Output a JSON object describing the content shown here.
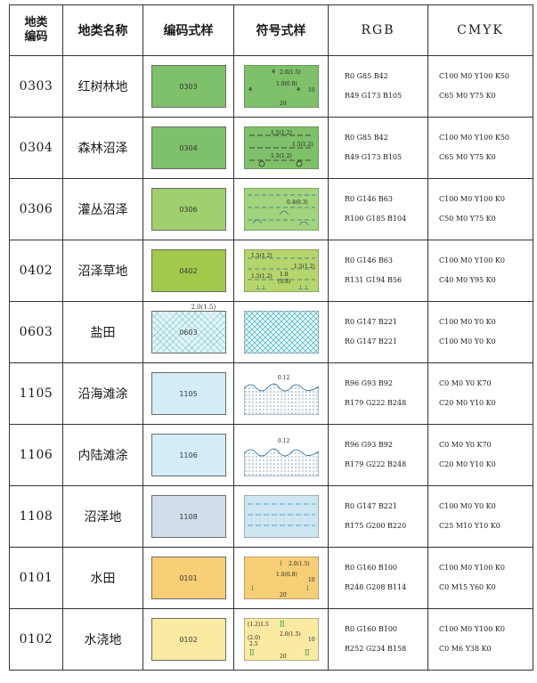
{
  "headers": {
    "code": "地类\n编码",
    "name": "地类名称",
    "swatch": "编码式样",
    "symbol": "符号式样",
    "rgb": "RGB",
    "cmyk": "CMYK"
  },
  "rows": [
    {
      "code": "0303",
      "name": "红树林地",
      "swatch_label": "0303",
      "swatch_color": "#7fc06a",
      "symbol_labels": [
        "2.0(1.5)",
        "1.0(0.8)",
        "10",
        "20"
      ],
      "rgb": [
        "R0  G85  B42",
        "R49  G173  B105"
      ],
      "cmyk": [
        "C100  M0  Y100  K50",
        "C65  M0  Y75  K0"
      ]
    },
    {
      "code": "0304",
      "name": "森林沼泽",
      "swatch_label": "0304",
      "swatch_color": "#7fc06a",
      "symbol_labels": [
        "1.5(1.2)",
        "1.5(1.2)",
        "1.5(1.2)"
      ],
      "rgb": [
        "R0  G85  B42",
        "R49  G173  B105"
      ],
      "cmyk": [
        "C100  M0  Y100  K50",
        "C65  M0  Y75  K0"
      ]
    },
    {
      "code": "0306",
      "name": "灌丛沼泽",
      "swatch_label": "0306",
      "swatch_color": "#9fcf6e",
      "symbol_labels": [
        "0.4(0.3)"
      ],
      "rgb": [
        "R0  G146  B63",
        "R100  G185  B104"
      ],
      "cmyk": [
        "C100  M0  Y100  K0",
        "C50  M0  Y75  K0"
      ]
    },
    {
      "code": "0402",
      "name": "沼泽草地",
      "swatch_label": "0402",
      "swatch_color": "#a3c94a",
      "symbol_labels": [
        "1.5(1.2)",
        "1.5(1.2)",
        "1.5(1.2)",
        "1.0",
        "(0.8)"
      ],
      "rgb": [
        "R0  G146  B63",
        "R131  G194  B56"
      ],
      "cmyk": [
        "C100  M0  Y100  K0",
        "C40  M0  Y95  K0"
      ]
    },
    {
      "code": "0603",
      "name": "盐田",
      "swatch_label": "0603",
      "swatch_color": "#e6f6f8",
      "swatch_note": "2.0(1.5)",
      "symbol_labels": [],
      "rgb": [
        "R0  G147  B221",
        "R0  G147  B221"
      ],
      "cmyk": [
        "C100  M0  Y0  K0",
        "C100  M0  Y0  K0"
      ]
    },
    {
      "code": "1105",
      "name": "沿海滩涂",
      "swatch_label": "1105",
      "swatch_color": "#d4eef7",
      "symbol_labels": [
        "0.12"
      ],
      "rgb": [
        "R96  G93  B92",
        "R179  G222  B248"
      ],
      "cmyk": [
        "C0  M0  Y0  K70",
        "C20  M0  Y10  K0"
      ]
    },
    {
      "code": "1106",
      "name": "内陆滩涂",
      "swatch_label": "1106",
      "swatch_color": "#d4eef7",
      "symbol_labels": [
        "0.12"
      ],
      "rgb": [
        "R96  G93  B92",
        "R179  G222  B248"
      ],
      "cmyk": [
        "C0  M0  Y0  K70",
        "C20  M0  Y10  K0"
      ]
    },
    {
      "code": "1108",
      "name": "沼泽地",
      "swatch_label": "1108",
      "swatch_color": "#d3deec",
      "symbol_labels": [],
      "rgb": [
        "R0  G147  B221",
        "R175  G200  B220"
      ],
      "cmyk": [
        "C100  M0  Y0  K0",
        "C25  M10  Y10  K0"
      ]
    },
    {
      "code": "0101",
      "name": "水田",
      "swatch_label": "0101",
      "swatch_color": "#f8cf77",
      "symbol_labels": [
        "2.0(1.5)",
        "1.0(0.8)",
        "10",
        "20"
      ],
      "rgb": [
        "R0  G160  B100",
        "R248  G208  B114"
      ],
      "cmyk": [
        "C100  M0  Y100  K0",
        "C0  M15  Y60  K0"
      ]
    },
    {
      "code": "0102",
      "name": "水浇地",
      "swatch_label": "0102",
      "swatch_color": "#fbeaa2",
      "symbol_labels": [
        "(1.2)1.5",
        "2.0(1.5)",
        "(2.0)",
        "2.5",
        "10",
        "20"
      ],
      "rgb": [
        "R0  G160  B100",
        "R252  G234  B158"
      ],
      "cmyk": [
        "C100  M0  Y100  K0",
        "C0  M6  Y38  K0"
      ]
    }
  ]
}
